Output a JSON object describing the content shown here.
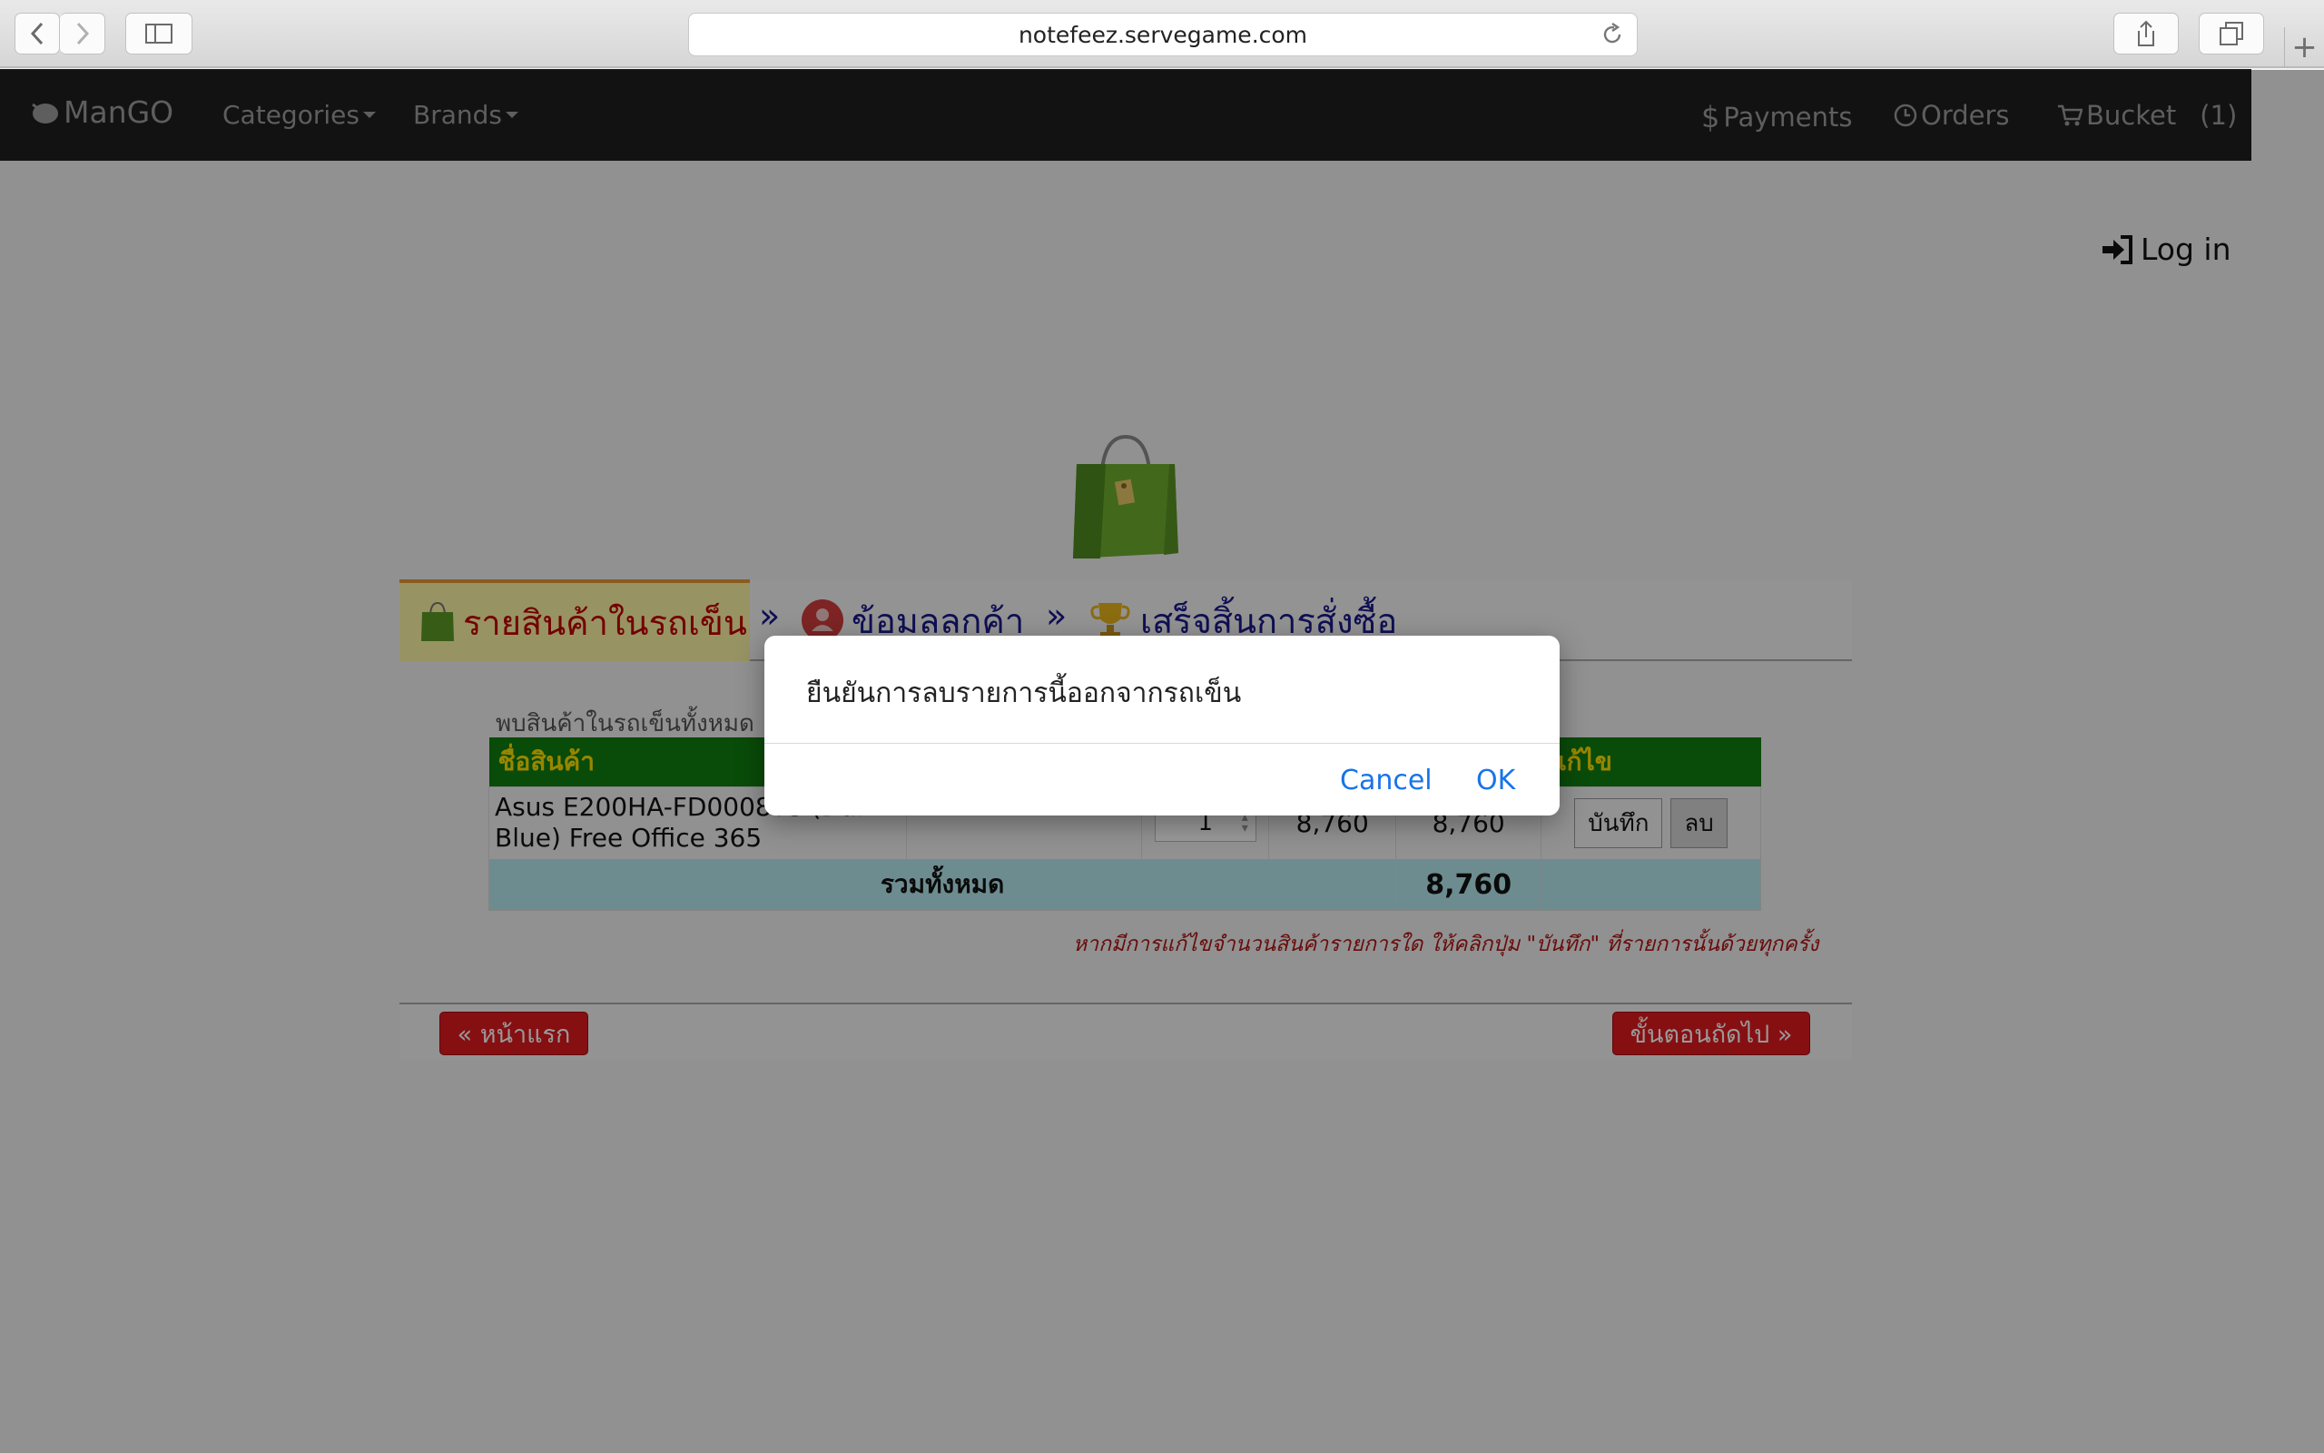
{
  "browser": {
    "url": "notefeez.servegame.com"
  },
  "navbar": {
    "brand": "ManGO",
    "categories": "Categories",
    "brands": "Brands",
    "payments": "Payments",
    "payments_symbol": "$",
    "orders": "Orders",
    "bucket": "Bucket",
    "bucket_count": "(1)"
  },
  "login": "Log in",
  "steps": {
    "step1": "รายสินค้าในรถเข็น",
    "sep": "»",
    "step2": "ข้อมลลกค้า",
    "step3": "เสร็จสิ้นการสั่งซื้อ"
  },
  "cart": {
    "found_text": "พบสินค้าในรถเข็นทั้งหมด",
    "headers": {
      "name": "ชื่อสินค้า",
      "edit": "แก้ไข"
    },
    "item": {
      "name_line1": "Asus E200HA-FD0008TS (Dark",
      "name_line2": "Blue) Free Office 365",
      "quantity": "1",
      "price": "8,760",
      "subtotal": "8,760",
      "save_label": "บันทึก",
      "delete_label": "ลบ"
    },
    "total_label": "รวมทั้งหมด",
    "total_value": "8,760",
    "note": "หากมีการแก้ไขจำนวนสินค้ารายการใด ให้คลิกปุ่ม \"บันทึก\" ที่รายการนั้นด้วยทุกครั้ง"
  },
  "footer": {
    "home_button": "« หน้าแรก",
    "next_button": "ขั้นตอนถัดไป »"
  },
  "dialog": {
    "message": "ยืนยันการลบรายการนี้ออกจากรถเข็น",
    "cancel": "Cancel",
    "ok": "OK"
  },
  "colors": {
    "navbar": "#1f1f1f",
    "table_header": "#0f7d0f",
    "table_header_text": "#ffe000",
    "total_row": "#b6eaf0",
    "red_button": "#e0191f",
    "dialog_link": "#1874e8"
  }
}
